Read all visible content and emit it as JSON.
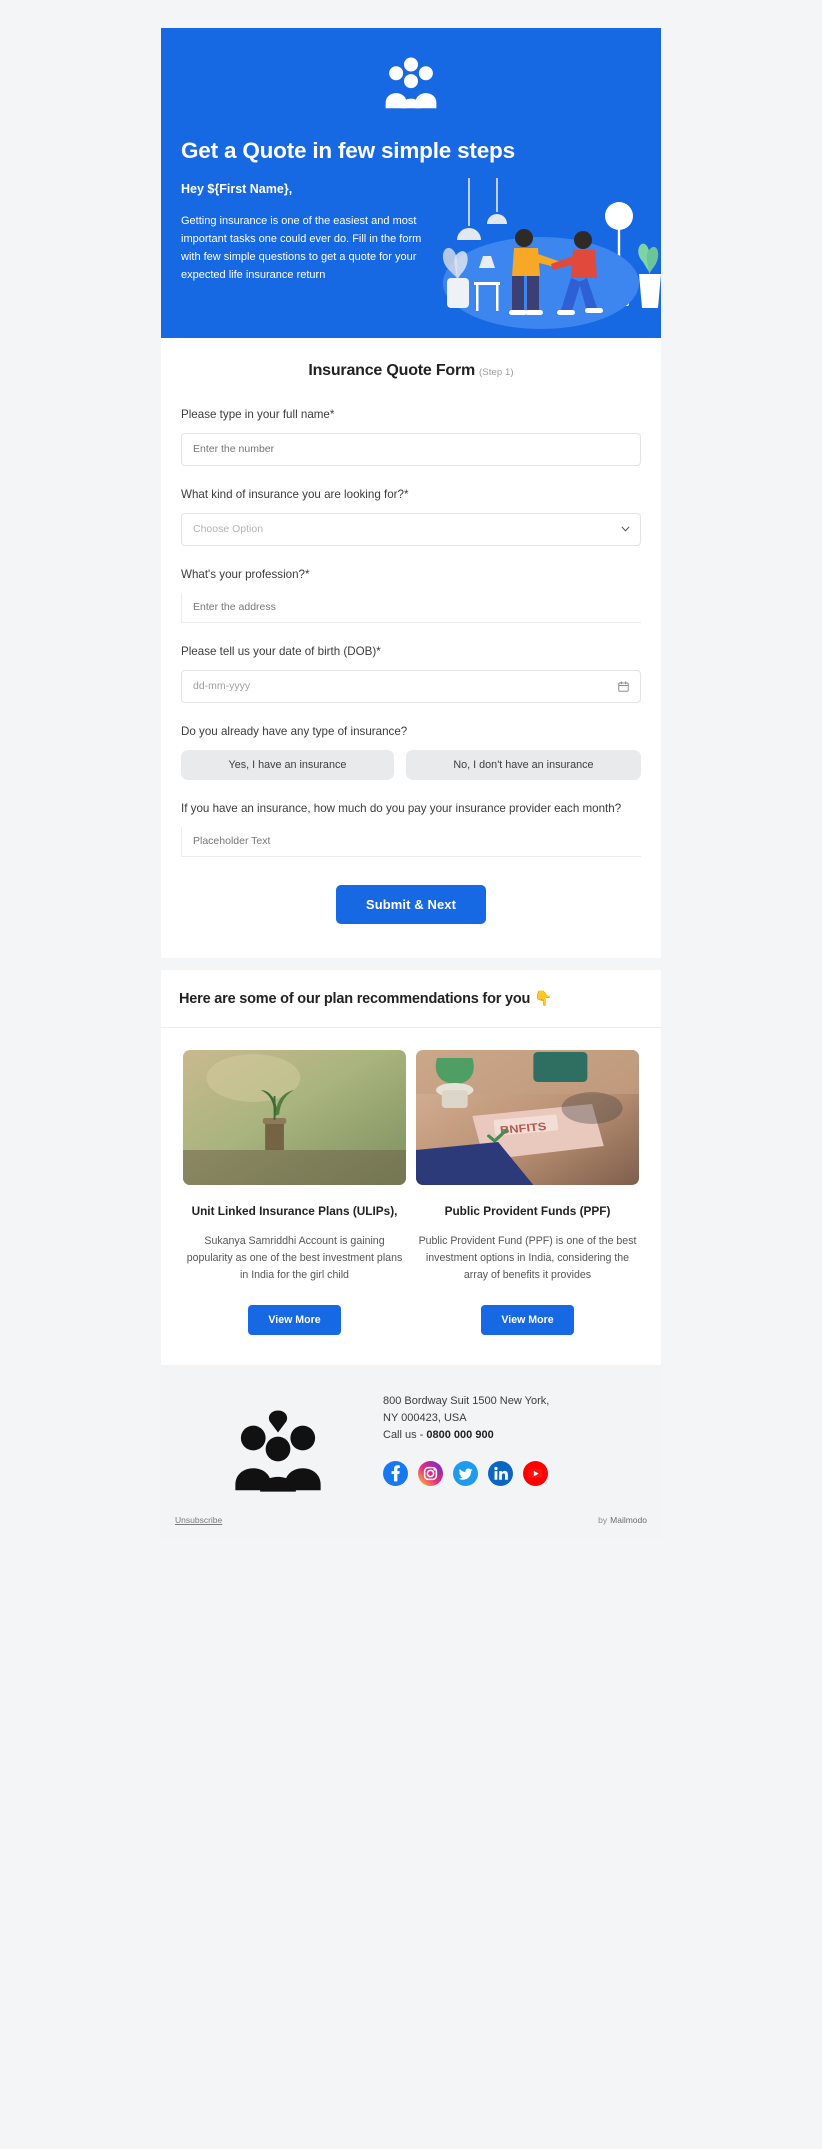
{
  "hero": {
    "logo_icon": "family-group-icon",
    "title": "Get a Quote in few simple steps",
    "greeting": "Hey ${First Name},",
    "body": "Getting insurance is one of the easiest and most important tasks one could ever do. Fill in the form with few simple questions to get a quote for your expected life insurance return",
    "bg_color": "#1668e3",
    "illustration": "people-shaking-hands-living-room-illustration"
  },
  "form": {
    "title": "Insurance Quote Form",
    "step": "(Step 1)",
    "fields": [
      {
        "label": "Please type in your full name*",
        "type": "text",
        "placeholder": "Enter the number",
        "value": ""
      },
      {
        "label": "What kind of insurance you are looking for?*",
        "type": "select",
        "placeholder": "Choose Option",
        "value": "",
        "icon": "chevron-down-icon"
      },
      {
        "label": "What's your profession?*",
        "type": "text-underline",
        "placeholder": "Enter the address",
        "value": ""
      },
      {
        "label": "Please tell us your date of birth (DOB)*",
        "type": "date",
        "placeholder": "dd-mm-yyyy",
        "value": "",
        "icon": "calendar-icon"
      }
    ],
    "choice_question": {
      "label": "Do you already have any type of insurance?",
      "options": [
        "Yes, I have an insurance",
        "No, I don't have an insurance"
      ]
    },
    "amount_question": {
      "label": "If you have an insurance, how much do you pay your insurance provider each month?",
      "placeholder": "Placeholder Text",
      "value": ""
    },
    "submit_label": "Submit & Next",
    "accent_color": "#1668e3"
  },
  "recommendations": {
    "heading": "Here are some of our plan recommendations for you 👇",
    "cards": [
      {
        "image": "plant-growing-in-coin-jar-photo",
        "title": "Unit Linked Insurance Plans (ULIPs),",
        "description": "Sukanya Samriddhi Account is gaining popularity as one of the best investment plans in India for the girl child",
        "button_label": "View More"
      },
      {
        "image": "person-reading-benefits-newspaper-photo",
        "title": "Public Provident Funds (PPF)",
        "description": "Public Provident Fund (PPF) is one of the best investment options in India, considering the array of benefits it provides",
        "button_label": "View More"
      }
    ]
  },
  "footer": {
    "logo_icon": "family-group-icon-dark",
    "address_line_1": "800 Bordway Suit 1500 New York,",
    "address_line_2": "NY 000423, USA",
    "call_prefix": "Call us - ",
    "phone": "0800 000 900",
    "socials": [
      {
        "name": "facebook-icon",
        "label": "Facebook"
      },
      {
        "name": "instagram-icon",
        "label": "Instagram"
      },
      {
        "name": "twitter-icon",
        "label": "Twitter"
      },
      {
        "name": "linkedin-icon",
        "label": "LinkedIn"
      },
      {
        "name": "youtube-icon",
        "label": "YouTube"
      }
    ],
    "unsubscribe_label": "Unsubscribe",
    "made_by_prefix": "by",
    "made_by_brand": "Mailmodo"
  }
}
